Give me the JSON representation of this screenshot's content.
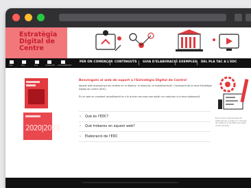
{
  "browser": {
    "controls": [
      "close",
      "minimize",
      "maximize"
    ]
  },
  "banner": {
    "logo_text": "Estratègia Digital de Centre"
  },
  "nav": {
    "icon_links": [
      {
        "icon": "home-icon",
        "label": "INICI"
      },
      {
        "icon": "document-icon",
        "label": "EDC"
      },
      {
        "icon": "grid-icon",
        "label": "FAQ"
      },
      {
        "icon": "mail-icon",
        "label": "CONTACTE"
      },
      {
        "icon": "link-icon",
        "label": "ACCESSIBILITAT"
      }
    ],
    "items": [
      "PER ON COMENÇAR",
      "CONTINGUTS",
      "GUIA D'ELABORACIÓ",
      "EXEMPLES",
      "DEL PLA TAC A L'EDC"
    ]
  },
  "main": {
    "heading": "Benvinguts al web de suport a l'Estratègia Digital de Centre!",
    "intro": "Aquest web acompanya els centres en el disseny, la redacció, la implementació i l'avaluació de la seva Estratègia Digital de Centre (EDC).",
    "intro2": "És un web en constant actualització on s'hi aniran recursos que ajudin en cada pas a la seva elaboració.",
    "accordion": [
      {
        "label": "Què és l'EDC?",
        "chevron": "›"
      },
      {
        "label": "Què trobareu en aquest web?",
        "chevron": "›"
      },
      {
        "label": "Elaboració de l'EDC",
        "chevron": "›"
      }
    ]
  },
  "covers": {
    "year_text": "2020|2023"
  },
  "sidebar": {
    "note": "Els recursos d'aquest web són elaborats per a ajudar en cada pas de l'elaboració de l'EDC del vostre centre educatiu"
  },
  "colors": {
    "accent": "#e03a3e",
    "banner_pink": "#f1777b",
    "nav_bg": "#111111"
  }
}
